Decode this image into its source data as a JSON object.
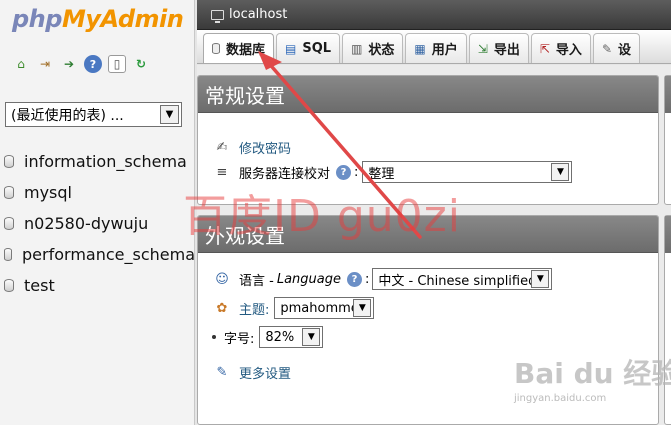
{
  "nav": {
    "logo_php": "php",
    "logo_my": "My",
    "logo_admin": "Admin",
    "icons": [
      "home-icon",
      "logout-icon",
      "query-window-icon",
      "docs-icon",
      "wiki-icon",
      "reload-icon"
    ],
    "recent_select_value": "(最近使用的表) ...",
    "databases": [
      "information_schema",
      "mysql",
      "n02580-dywuju",
      "performance_schema",
      "test"
    ]
  },
  "serverbar": {
    "server": "localhost"
  },
  "tabs": [
    {
      "label": "数据库",
      "icon": "database-icon"
    },
    {
      "label": "SQL",
      "icon": "sql-icon"
    },
    {
      "label": "状态",
      "icon": "status-icon"
    },
    {
      "label": "用户",
      "icon": "users-icon"
    },
    {
      "label": "导出",
      "icon": "export-icon"
    },
    {
      "label": "导入",
      "icon": "import-icon"
    },
    {
      "label": "设",
      "icon": "settings-icon"
    }
  ],
  "general": {
    "title": "常规设置",
    "change_password": "修改密码",
    "collation_label": "服务器连接校对",
    "collation_value": "整理"
  },
  "appearance": {
    "title": "外观设置",
    "language_label": "语言 - ",
    "language_label_en": "Language",
    "language_value": "中文 - Chinese simplified",
    "theme_label": "主题:",
    "theme_value": "pmahomme",
    "fontsize_label": "字号:",
    "fontsize_value": "82%",
    "more_settings": "更多设置"
  },
  "overlays": {
    "watermark": "百度ID gu0zi",
    "baidu_logo": "Bai du 经验",
    "baidu_url": "jingyan.baidu.com"
  },
  "colors": {
    "accent": "#f29400",
    "link": "#235a81",
    "arrow": "#e04848",
    "panel_header": "#7a7a7a"
  }
}
